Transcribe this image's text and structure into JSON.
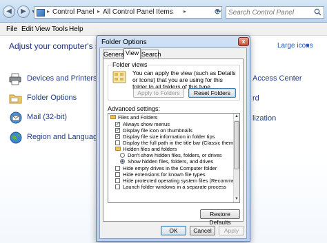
{
  "address_bar": {
    "crumbs": [
      "Control Panel",
      "All Control Panel Items"
    ],
    "search_placeholder": "Search Control Panel"
  },
  "menu": [
    "File",
    "Edit",
    "View",
    "Tools",
    "Help"
  ],
  "control_panel": {
    "heading": "Adjust your computer's settings",
    "view_by_value": "Large icons",
    "items": [
      {
        "label": "Devices and Printers",
        "icon": "printer-icon"
      },
      {
        "label": "Folder Options",
        "icon": "folder-icon"
      },
      {
        "label": "Mail (32-bit)",
        "icon": "mail-icon"
      },
      {
        "label": "Region and Language",
        "icon": "globe-icon"
      }
    ],
    "right_fragments": [
      "Access Center",
      "rd",
      "lization"
    ]
  },
  "dialog": {
    "title": "Folder Options",
    "close_label": "x",
    "tabs": [
      "General",
      "View",
      "Search"
    ],
    "active_tab": "View",
    "folder_views": {
      "title": "Folder views",
      "description": "You can apply the view (such as Details or Icons) that you are using for this folder to all folders of this type.",
      "apply_button": "Apply to Folders",
      "reset_button": "Reset Folders"
    },
    "advanced_label": "Advanced settings:",
    "advanced_items": [
      {
        "label": "Files and Folders",
        "kind": "folder",
        "indent": 0
      },
      {
        "label": "Always show menus",
        "kind": "checkbox",
        "checked": true,
        "indent": 1
      },
      {
        "label": "Display file icon on thumbnails",
        "kind": "checkbox",
        "checked": true,
        "indent": 1
      },
      {
        "label": "Display file size information in folder tips",
        "kind": "checkbox",
        "checked": true,
        "indent": 1
      },
      {
        "label": "Display the full path in the title bar (Classic theme only)",
        "kind": "checkbox",
        "checked": false,
        "indent": 1
      },
      {
        "label": "Hidden files and folders",
        "kind": "folder",
        "indent": 1
      },
      {
        "label": "Don't show hidden files, folders, or drives",
        "kind": "radio",
        "checked": false,
        "indent": 2
      },
      {
        "label": "Show hidden files, folders, and drives",
        "kind": "radio",
        "checked": true,
        "indent": 2
      },
      {
        "label": "Hide empty drives in the Computer folder",
        "kind": "checkbox",
        "checked": false,
        "indent": 1
      },
      {
        "label": "Hide extensions for known file types",
        "kind": "checkbox",
        "checked": false,
        "indent": 1
      },
      {
        "label": "Hide protected operating system files (Recommended)",
        "kind": "checkbox",
        "checked": false,
        "indent": 1
      },
      {
        "label": "Launch folder windows in a separate process",
        "kind": "checkbox",
        "checked": false,
        "indent": 1
      }
    ],
    "restore_defaults": "Restore Defaults",
    "ok": "OK",
    "cancel": "Cancel",
    "apply": "Apply"
  }
}
